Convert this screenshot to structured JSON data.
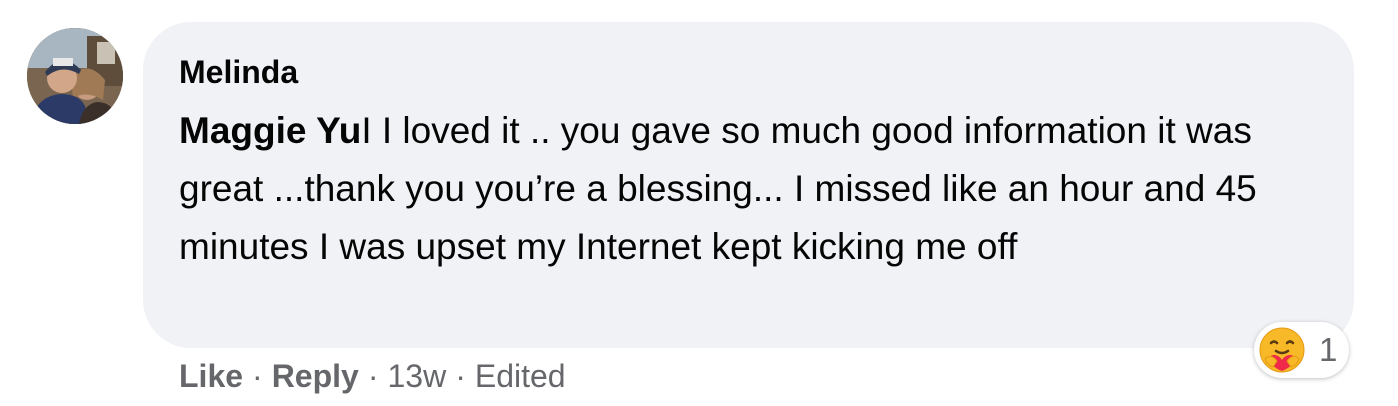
{
  "comment": {
    "author": "Melinda",
    "mention": "Maggie Yu",
    "text": "I I loved it .. you gave so much good information it was great ...thank you you’re a blessing... I missed like an hour and 45 minutes I was upset my Internet kept kicking me off",
    "avatar_icon": "profile-photo"
  },
  "actions": {
    "like_label": "Like",
    "reply_label": "Reply",
    "separator": "·",
    "time": "13w",
    "edited_label": "Edited"
  },
  "reaction": {
    "icon": "care-emoji-icon",
    "count": "1"
  },
  "colors": {
    "bubble_bg": "#f0f2f5",
    "meta_text": "#65676b",
    "text": "#050505"
  }
}
